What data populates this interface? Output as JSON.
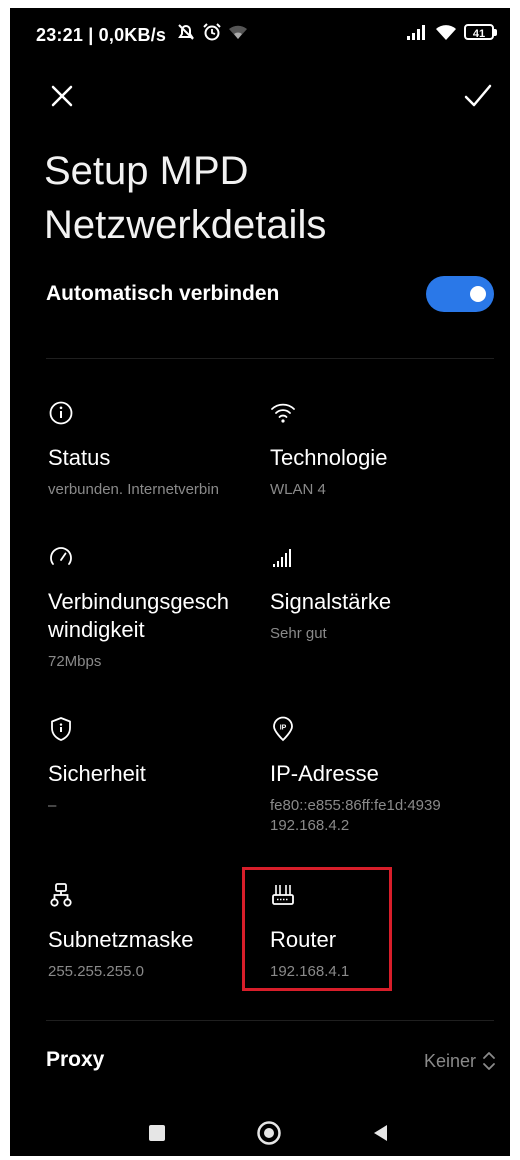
{
  "status_bar": {
    "time_and_speed": "23:21 | 0,0KB/s",
    "battery_level": "41",
    "icons_left": [
      "muted-alarm-icon",
      "alarm-clock-icon",
      "wifi-weak-icon"
    ],
    "icons_right": [
      "signal-bars-icon",
      "wifi-icon",
      "battery-icon"
    ]
  },
  "toolbar": {
    "close_icon": "close-icon",
    "confirm_icon": "checkmark-icon"
  },
  "page": {
    "title_line1": "Setup MPD",
    "title_line2": "Netzwerkdetails"
  },
  "auto_connect": {
    "label": "Automatisch verbinden",
    "enabled": true,
    "accent_color": "#2a78e8"
  },
  "details": [
    {
      "icon": "info-icon",
      "label": "Status",
      "value": "verbunden. Internetverbin"
    },
    {
      "icon": "wifi-icon",
      "label": "Technologie",
      "value": "WLAN 4"
    },
    {
      "icon": "speedometer-icon",
      "label": "Verbindungsgesch windigkeit",
      "label_line1": "Verbindungsgesch",
      "label_line2": "windigkeit",
      "value": "72Mbps"
    },
    {
      "icon": "signal-strength-icon",
      "label": "Signalstärke",
      "value": "Sehr gut"
    },
    {
      "icon": "shield-icon",
      "label": "Sicherheit",
      "value": "–"
    },
    {
      "icon": "ip-pin-icon",
      "label": "IP-Adresse",
      "value_line1": "fe80::e855:86ff:fe1d:4939",
      "value_line2": "192.168.4.2"
    },
    {
      "icon": "network-tree-icon",
      "label": "Subnetzmaske",
      "value": "255.255.255.0"
    },
    {
      "icon": "router-icon",
      "label": "Router",
      "value": "192.168.4.1"
    }
  ],
  "proxy": {
    "label": "Proxy",
    "value": "Keiner"
  },
  "nav": {
    "icons": [
      "recent-apps-icon",
      "home-icon",
      "back-icon"
    ]
  },
  "colors": {
    "highlight": "#d81e2a",
    "background": "#000000",
    "secondary_text": "#8a8a8a"
  }
}
